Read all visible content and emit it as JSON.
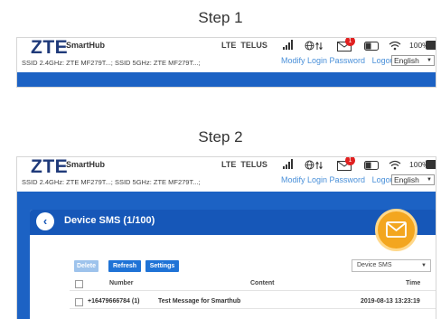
{
  "step1": {
    "title": "Step 1"
  },
  "step2": {
    "title": "Step 2"
  },
  "header": {
    "logo": "ZTE",
    "product": "SmartHub",
    "ssid": "SSID 2.4GHz: ZTE MF279T...; SSID 5GHz: ZTE MF279T...;",
    "network_type": "LTE",
    "carrier": "TELUS",
    "sms_badge": "1",
    "battery": "100%",
    "links": {
      "modify_password": "Modify Login Password",
      "logout": "Logout"
    },
    "language": "English"
  },
  "sms_page": {
    "title": "Device SMS (1/100)",
    "buttons": {
      "delete": "Delete",
      "refresh": "Refresh",
      "settings": "Settings"
    },
    "filter": {
      "selected": "Device SMS"
    },
    "columns": {
      "number": "Number",
      "content": "Content",
      "time": "Time"
    },
    "messages": [
      {
        "number": "+16479666784 (1)",
        "content": "Test Message for Smarthub",
        "time": "2019-08-13 13:23:19"
      }
    ]
  },
  "colors": {
    "brand_blue": "#1c62c4",
    "logo_navy": "#1f3a7a",
    "link_blue": "#4a90d9",
    "accent_orange": "#f3a61f",
    "badge_red": "#e02020"
  },
  "icons": [
    "signal-icon",
    "globe-icon",
    "transfer-arrows-icon",
    "mail-icon",
    "sim-icon",
    "wifi-icon",
    "battery-icon",
    "back-arrow-icon",
    "envelope-icon"
  ]
}
